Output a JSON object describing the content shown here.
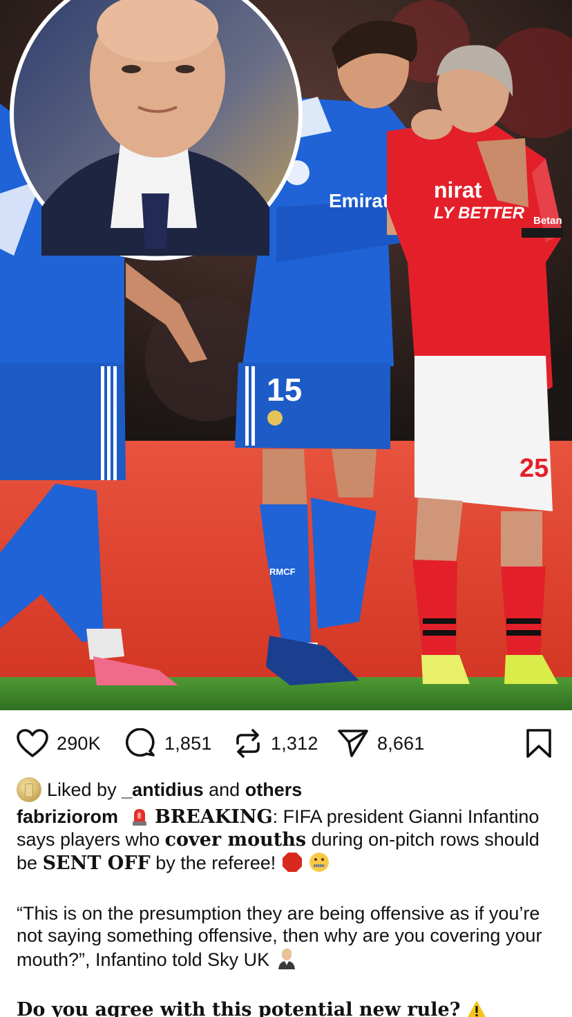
{
  "photo": {
    "alt": "",
    "jersey_blue": {
      "sponsor": "Emirat",
      "number": "15",
      "sock_text": "RMCF"
    },
    "jersey_red": {
      "sponsor": "nirat",
      "sponsor_line2": "LY BETTER",
      "sleeve": "Betan",
      "number": "25"
    }
  },
  "actions": {
    "likes": "290K",
    "comments": "1,851",
    "reposts": "1,312",
    "shares": "8,661"
  },
  "liked_by": {
    "prefix": "Liked by",
    "user": "_antidius",
    "and": "and",
    "others": "others"
  },
  "caption": {
    "username": "fabriziorom",
    "breaking": "BREAKING",
    "line1_rest": ": FIFA president Gianni Infantino says players who",
    "cover_mouths": "cover mouths",
    "line2_rest": "during on-pitch rows should be",
    "sent_off": "SENT OFF",
    "line3_rest": "by the referee!",
    "quote": "“This is on the presumption they are being offensive as if you’re not saying something offensive, then why are you covering your mouth?”, Infantino told Sky UK",
    "question": "Do you agree with this potential new rule?"
  },
  "colors": {
    "pitch_board": "#e2412f",
    "blue_kit": "#1f63d6",
    "red_kit": "#e3202a",
    "grass": "#3f8a2a"
  }
}
